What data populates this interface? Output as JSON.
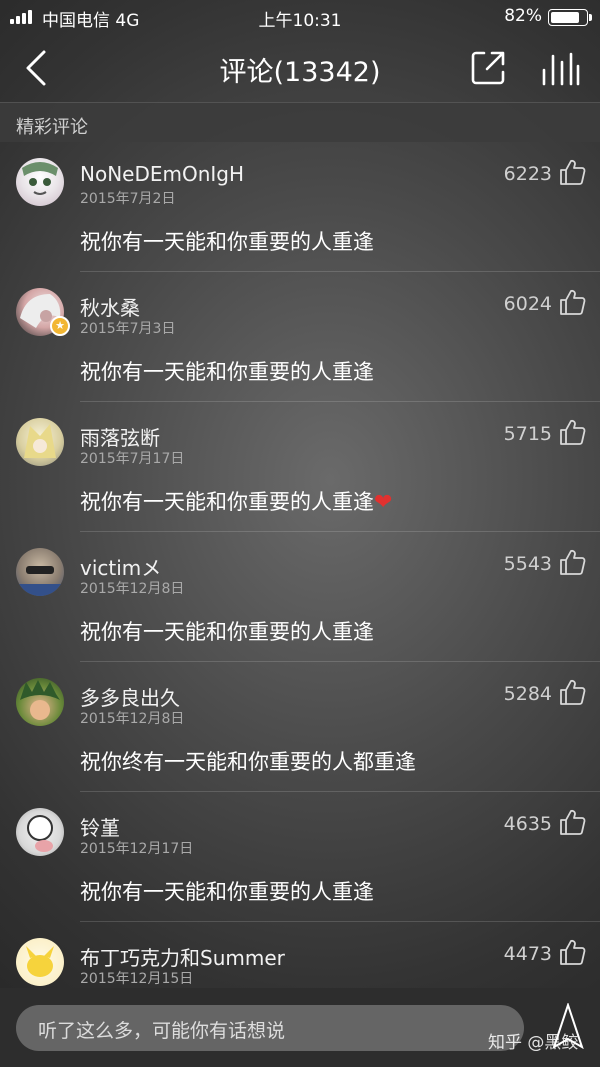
{
  "status_bar": {
    "carrier": "中国电信  4G",
    "time": "上午10:31",
    "battery": "82%",
    "battery_level": 0.82
  },
  "nav": {
    "title": "评论(13342)"
  },
  "section_header": "精彩评论",
  "comments": [
    {
      "user": "NoNeDEmOnIgH",
      "date": "2015年7月2日",
      "likes": "6223",
      "text": "祝你有一天能和你重要的人重逢"
    },
    {
      "user": "秋水桑",
      "date": "2015年7月3日",
      "likes": "6024",
      "text": "祝你有一天能和你重要的人重逢"
    },
    {
      "user": "雨落弦断",
      "date": "2015年7月17日",
      "likes": "5715",
      "text": "祝你有一天能和你重要的人重逢"
    },
    {
      "user": "victimメ",
      "date": "2015年12月8日",
      "likes": "5543",
      "text": "祝你有一天能和你重要的人重逢"
    },
    {
      "user": "多多良出久",
      "date": "2015年12月8日",
      "likes": "5284",
      "text": "祝你终有一天能和你重要的人都重逢"
    },
    {
      "user": "铃堇",
      "date": "2015年12月17日",
      "likes": "4635",
      "text": "祝你有一天能和你重要的人重逢"
    },
    {
      "user": "布丁巧克力和Summer",
      "date": "2015年12月15日",
      "likes": "4473"
    }
  ],
  "input": {
    "placeholder": "听了这么多，可能你有话想说"
  },
  "watermark": "知乎 @黑鲛",
  "colors": {
    "heart": "#e1312f",
    "vip_badge": "#f2b633"
  }
}
